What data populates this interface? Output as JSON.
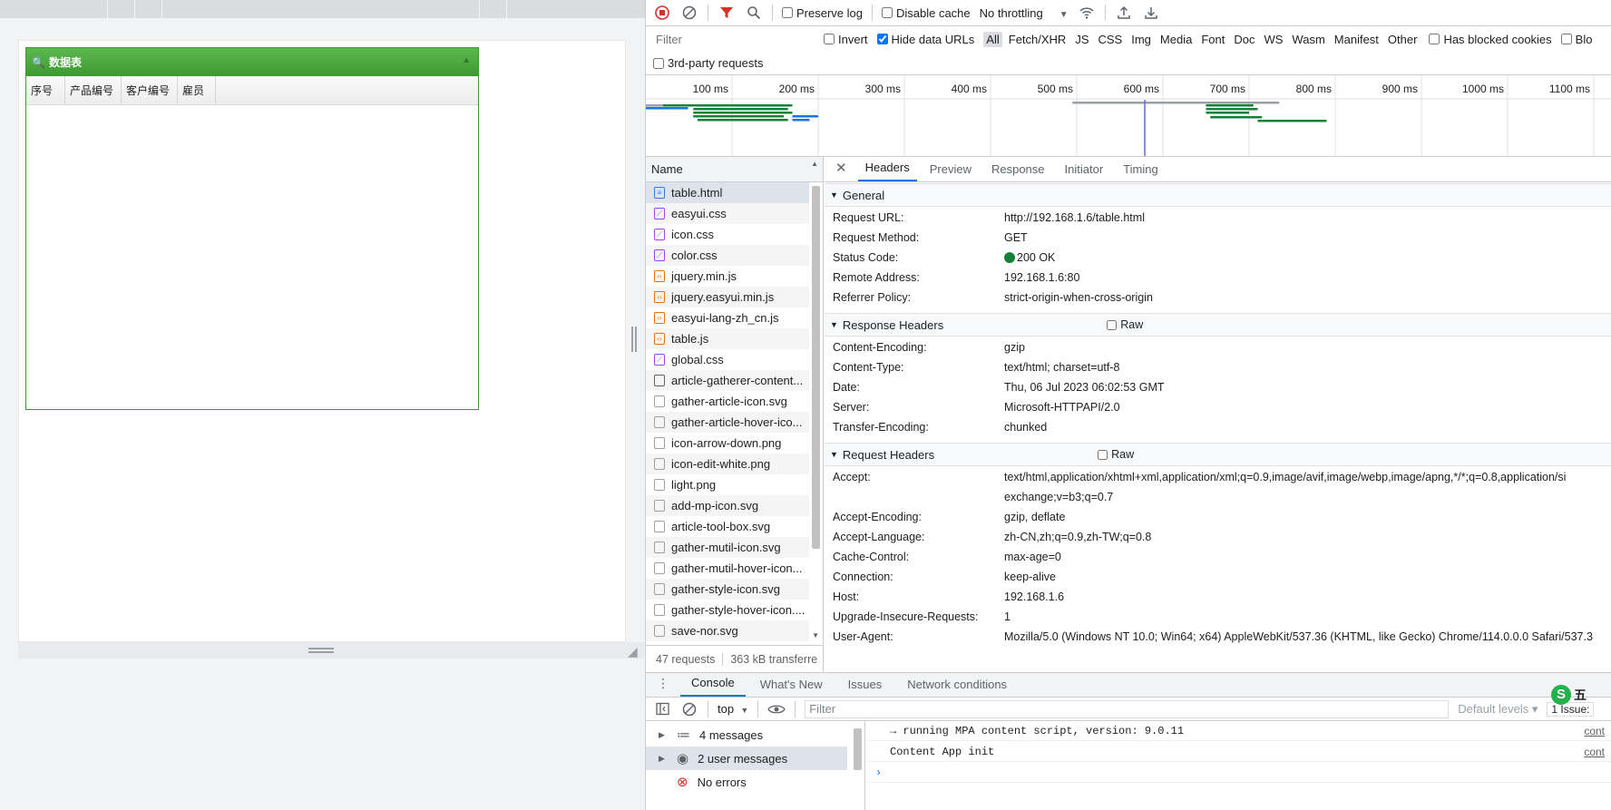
{
  "page": {
    "grid_title": "数据表",
    "columns": [
      "序号",
      "产品编号",
      "客户编号",
      "雇员"
    ]
  },
  "toolbar": {
    "preserve_log": "Preserve log",
    "disable_cache": "Disable cache",
    "throttling": "No throttling"
  },
  "filterbar": {
    "placeholder": "Filter",
    "invert": "Invert",
    "hide_data_urls": "Hide data URLs",
    "types": [
      "All",
      "Fetch/XHR",
      "JS",
      "CSS",
      "Img",
      "Media",
      "Font",
      "Doc",
      "WS",
      "Wasm",
      "Manifest",
      "Other"
    ],
    "has_blocked_cookies": "Has blocked cookies",
    "blocked_truncated": "Blo",
    "third_party": "3rd-party requests"
  },
  "timeline": {
    "ticks": [
      "100 ms",
      "200 ms",
      "300 ms",
      "400 ms",
      "500 ms",
      "600 ms",
      "700 ms",
      "800 ms",
      "900 ms",
      "1000 ms",
      "1100 ms"
    ]
  },
  "requests": {
    "header": "Name",
    "items": [
      {
        "name": "table.html",
        "type": "doc"
      },
      {
        "name": "easyui.css",
        "type": "css"
      },
      {
        "name": "icon.css",
        "type": "css"
      },
      {
        "name": "color.css",
        "type": "css"
      },
      {
        "name": "jquery.min.js",
        "type": "js"
      },
      {
        "name": "jquery.easyui.min.js",
        "type": "js"
      },
      {
        "name": "easyui-lang-zh_cn.js",
        "type": "js"
      },
      {
        "name": "table.js",
        "type": "js"
      },
      {
        "name": "global.css",
        "type": "css"
      },
      {
        "name": "article-gatherer-content...",
        "type": "blank"
      },
      {
        "name": "gather-article-icon.svg",
        "type": "img"
      },
      {
        "name": "gather-article-hover-ico...",
        "type": "img"
      },
      {
        "name": "icon-arrow-down.png",
        "type": "img"
      },
      {
        "name": "icon-edit-white.png",
        "type": "img"
      },
      {
        "name": "light.png",
        "type": "img"
      },
      {
        "name": "add-mp-icon.svg",
        "type": "img"
      },
      {
        "name": "article-tool-box.svg",
        "type": "img"
      },
      {
        "name": "gather-mutil-icon.svg",
        "type": "img"
      },
      {
        "name": "gather-mutil-hover-icon...",
        "type": "img"
      },
      {
        "name": "gather-style-icon.svg",
        "type": "img"
      },
      {
        "name": "gather-style-hover-icon....",
        "type": "img"
      },
      {
        "name": "save-nor.svg",
        "type": "img"
      }
    ],
    "summary_count": "47 requests",
    "summary_transfer": "363 kB transferre"
  },
  "details": {
    "tabs": [
      "Headers",
      "Preview",
      "Response",
      "Initiator",
      "Timing"
    ],
    "general_title": "General",
    "general": [
      {
        "k": "Request URL:",
        "v": "http://192.168.1.6/table.html"
      },
      {
        "k": "Request Method:",
        "v": "GET"
      },
      {
        "k": "Status Code:",
        "v": "200 OK"
      },
      {
        "k": "Remote Address:",
        "v": "192.168.1.6:80"
      },
      {
        "k": "Referrer Policy:",
        "v": "strict-origin-when-cross-origin"
      }
    ],
    "response_title": "Response Headers",
    "raw_label": "Raw",
    "response": [
      {
        "k": "Content-Encoding:",
        "v": "gzip"
      },
      {
        "k": "Content-Type:",
        "v": "text/html; charset=utf-8"
      },
      {
        "k": "Date:",
        "v": "Thu, 06 Jul 2023 06:02:53 GMT"
      },
      {
        "k": "Server:",
        "v": "Microsoft-HTTPAPI/2.0"
      },
      {
        "k": "Transfer-Encoding:",
        "v": "chunked"
      }
    ],
    "request_title": "Request Headers",
    "request": [
      {
        "k": "Accept:",
        "v": "text/html,application/xhtml+xml,application/xml;q=0.9,image/avif,image/webp,image/apng,*/*;q=0.8,application/si"
      },
      {
        "k": "",
        "v": "exchange;v=b3;q=0.7"
      },
      {
        "k": "Accept-Encoding:",
        "v": "gzip, deflate"
      },
      {
        "k": "Accept-Language:",
        "v": "zh-CN,zh;q=0.9,zh-TW;q=0.8"
      },
      {
        "k": "Cache-Control:",
        "v": "max-age=0"
      },
      {
        "k": "Connection:",
        "v": "keep-alive"
      },
      {
        "k": "Host:",
        "v": "192.168.1.6"
      },
      {
        "k": "Upgrade-Insecure-Requests:",
        "v": "1"
      },
      {
        "k": "User-Agent:",
        "v": "Mozilla/5.0 (Windows NT 10.0; Win64; x64) AppleWebKit/537.36 (KHTML, like Gecko) Chrome/114.0.0.0 Safari/537.3"
      }
    ]
  },
  "drawer": {
    "tabs": [
      "Console",
      "What's New",
      "Issues",
      "Network conditions"
    ],
    "context": "top",
    "filter_placeholder": "Filter",
    "levels": "Default levels ▾",
    "issues": "1 Issue:",
    "ime_label": "五",
    "sidebar": [
      "4 messages",
      "2 user messages",
      "No errors"
    ],
    "log": [
      {
        "text": "→ running MPA content script, version: 9.0.11",
        "src": "cont"
      },
      {
        "text": "Content App init",
        "src": "cont"
      }
    ]
  },
  "colors": {
    "grid_header": "#4caf50",
    "selected_tab": "#1a73e8",
    "record": "#d93025"
  }
}
